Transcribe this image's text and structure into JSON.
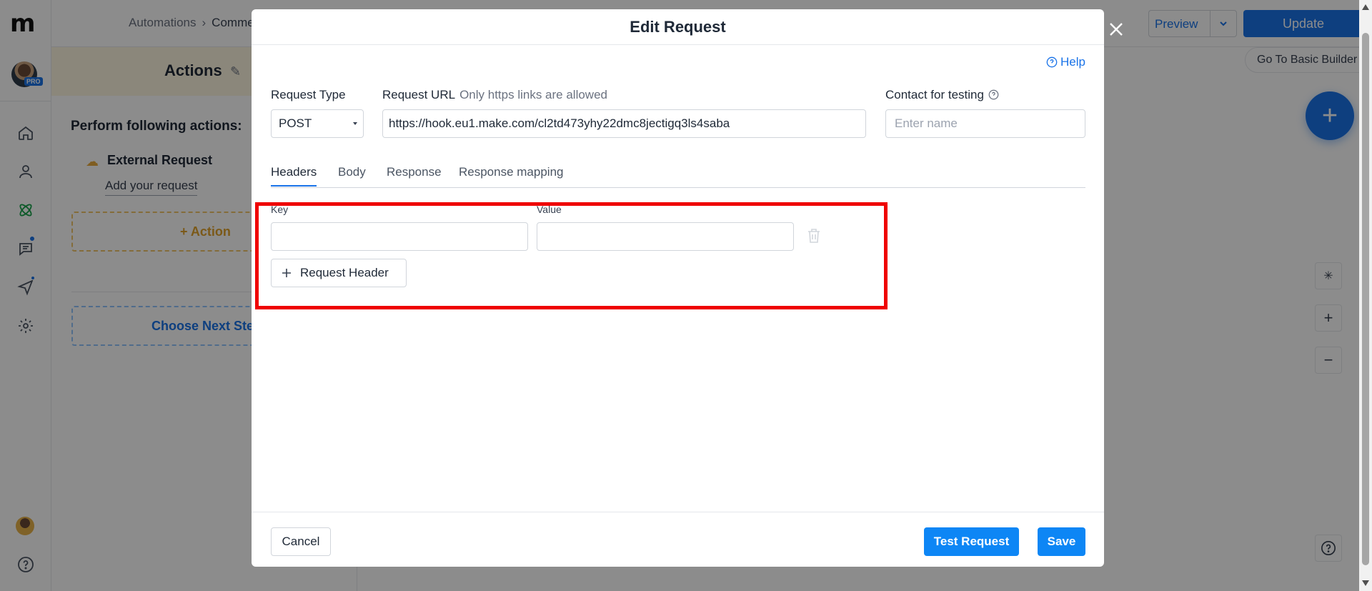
{
  "app": {
    "logo_text": "m",
    "pro_badge": "PRO"
  },
  "header": {
    "breadcrumb": [
      "Automations",
      "Comment Auto"
    ],
    "preview_label": "Preview",
    "update_label": "Update"
  },
  "panel": {
    "title": "Actions",
    "perform_label": "Perform following actions:",
    "external_request_title": "External Request",
    "external_request_sub": "Add your request",
    "add_action_label": "+ Action",
    "next_step_label": "Choose Next Step"
  },
  "canvas": {
    "basic_builder_label": "Go To Basic Builder"
  },
  "modal": {
    "title": "Edit Request",
    "help_label": "Help",
    "request_type_label": "Request Type",
    "request_type_value": "POST",
    "request_url_label": "Request URL",
    "request_url_hint": "Only https links are allowed",
    "request_url_value": "https://hook.eu1.make.com/cl2td473yhy22dmc8jectigq3ls4saba",
    "contact_label": "Contact for testing",
    "contact_placeholder": "Enter name",
    "tabs": [
      "Headers",
      "Body",
      "Response",
      "Response mapping"
    ],
    "key_label": "Key",
    "value_label": "Value",
    "add_header_label": "Request Header",
    "cancel_label": "Cancel",
    "test_label": "Test Request",
    "save_label": "Save"
  },
  "colors": {
    "accent": "#1a73e8",
    "primary_button": "#0d86f5",
    "highlight": "#ef0000",
    "action_text": "#e0a32d"
  }
}
